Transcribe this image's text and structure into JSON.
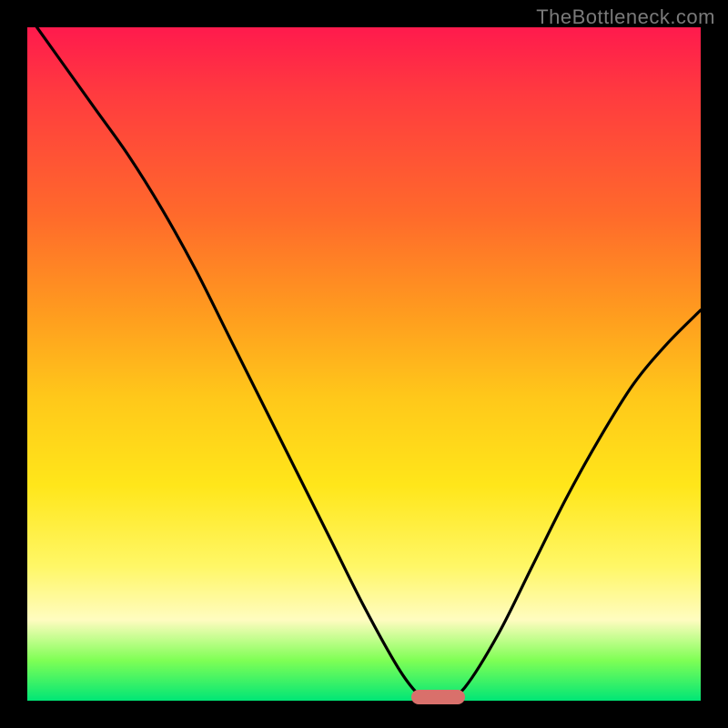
{
  "watermark": "TheBottleneck.com",
  "colors": {
    "frame": "#000000",
    "curve": "#000000",
    "marker": "#d9706b",
    "gradient_stops": [
      "#ff1a4d",
      "#ff3b3f",
      "#ff6a2b",
      "#ff9a1f",
      "#ffc81a",
      "#ffe61a",
      "#fff766",
      "#fffcc0",
      "#7fff55",
      "#00e676"
    ]
  },
  "chart_data": {
    "type": "line",
    "title": "",
    "xlabel": "",
    "ylabel": "",
    "xlim": [
      0,
      100
    ],
    "ylim": [
      0,
      100
    ],
    "x": [
      0,
      5,
      10,
      15,
      20,
      25,
      30,
      35,
      40,
      45,
      50,
      55,
      58,
      60,
      62,
      65,
      70,
      75,
      80,
      85,
      90,
      95,
      100
    ],
    "values": [
      102,
      95,
      88,
      81,
      73,
      64,
      54,
      44,
      34,
      24,
      14,
      5,
      1,
      0,
      0,
      2,
      10,
      20,
      30,
      39,
      47,
      53,
      58
    ],
    "minimum_marker": {
      "x_center": 61,
      "y": 0,
      "width": 8
    },
    "grid": false,
    "legend": false
  }
}
